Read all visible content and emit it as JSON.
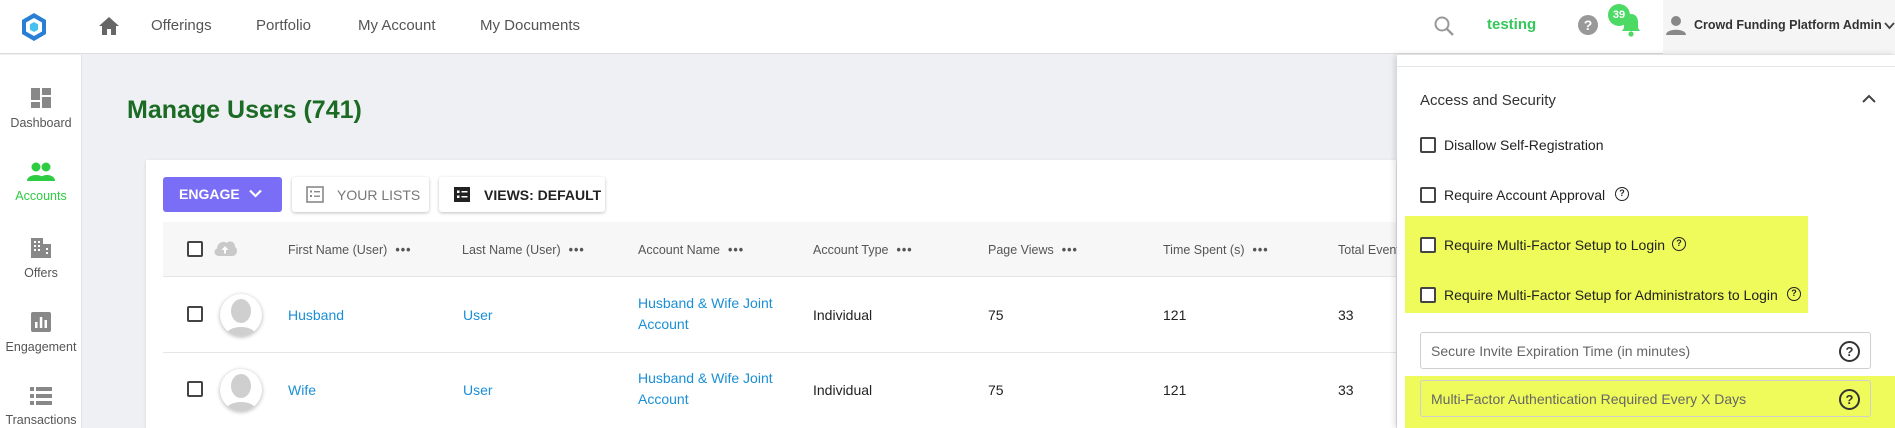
{
  "topbar": {
    "nav": [
      "Offerings",
      "Portfolio",
      "My Account",
      "My Documents"
    ],
    "tenant": "testing",
    "notifications_count": "39",
    "user_name": "Crowd Funding Platform Admin"
  },
  "sidebar": {
    "items": [
      {
        "label": "Dashboard",
        "icon": "dashboard-icon"
      },
      {
        "label": "Accounts",
        "icon": "accounts-icon",
        "active": true
      },
      {
        "label": "Offers",
        "icon": "offers-icon"
      },
      {
        "label": "Engagement",
        "icon": "engagement-icon"
      },
      {
        "label": "Transactions",
        "icon": "transactions-icon"
      }
    ]
  },
  "main": {
    "title": "Manage Users (741)",
    "toolbar": {
      "engage": "ENGAGE",
      "your_lists": "YOUR LISTS",
      "views": "VIEWS: DEFAULT"
    },
    "columns": [
      "First Name (User)",
      "Last Name (User)",
      "Account Name",
      "Account Type",
      "Page Views",
      "Time Spent (s)",
      "Total Events"
    ],
    "rows": [
      {
        "first": "Husband",
        "last": "User",
        "account": "Husband & Wife Joint Account",
        "type": "Individual",
        "views": "75",
        "time": "121",
        "events": "33"
      },
      {
        "first": "Wife",
        "last": "User",
        "account": "Husband & Wife Joint Account",
        "type": "Individual",
        "views": "75",
        "time": "121",
        "events": "33"
      }
    ]
  },
  "panel": {
    "section_title": "Access and Security",
    "options": [
      {
        "label": "Disallow Self-Registration",
        "help": false,
        "highlighted": false
      },
      {
        "label": "Require Account Approval",
        "help": true,
        "highlighted": false
      },
      {
        "label": "Require Multi-Factor Setup to Login",
        "help": true,
        "highlighted": true
      },
      {
        "label": "Require Multi-Factor Setup for Administrators to Login",
        "help": true,
        "highlighted": true
      }
    ],
    "invite_expiration_placeholder": "Secure Invite Expiration Time (in minutes)",
    "mfa_days_placeholder": "Multi-Factor Authentication Required Every X Days"
  },
  "colors": {
    "accent_green": "#2ecc40",
    "title_green": "#1b6b24",
    "engage_purple": "#7b6ef6",
    "link_blue": "#1a8fd6",
    "highlight_yellow": "#eefb5a"
  }
}
